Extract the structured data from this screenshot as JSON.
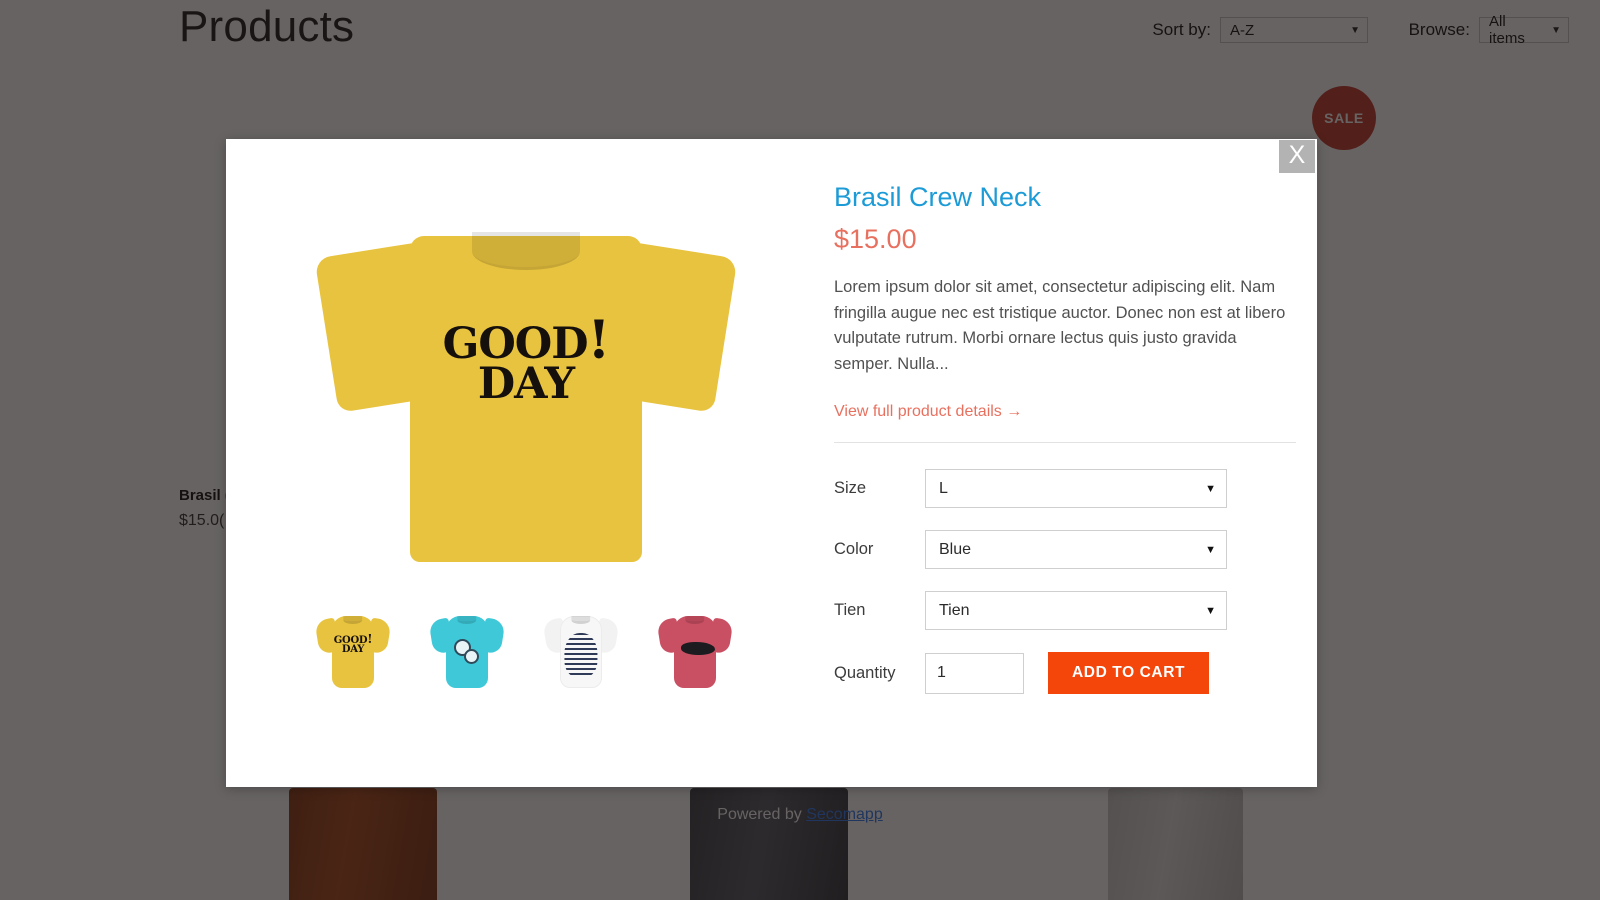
{
  "store": {
    "page_title": "Products",
    "sort": {
      "label": "Sort by:",
      "value": "A-Z",
      "caret": "▼"
    },
    "browse": {
      "label": "Browse:",
      "value": "All items",
      "caret": "▼"
    },
    "sale_badge": "SALE",
    "background_card": {
      "title": "Brasil (",
      "price": "$15.0("
    },
    "footer": {
      "prefix": "Powered by ",
      "link": "Secomapp"
    }
  },
  "modal": {
    "close_label": "X",
    "product": {
      "title": "Brasil Crew Neck",
      "price": "$15.00",
      "description": "Lorem ipsum dolor sit amet, consectetur adipiscing elit. Nam fringilla augue nec est tristique auctor. Donec non est at libero vulputate rutrum. Morbi ornare lectus quis justo gravida semper. Nulla...",
      "details_link": "View full product details →"
    },
    "gallery": {
      "hero": {
        "print_line1": "GOOD",
        "print_line2": "DAY",
        "print_bang": "!",
        "color": "#e8c33f"
      },
      "thumbnails": [
        {
          "name": "thumb-yellow-good-day",
          "color": "#e8c33f",
          "print_line1": "GOOD",
          "print_line2": "DAY",
          "print_bang": "!"
        },
        {
          "name": "thumb-turquoise-graphic",
          "color": "#3ec8d8",
          "print_line1": "",
          "print_line2": "",
          "print_bang": ""
        },
        {
          "name": "thumb-white-graphic",
          "color": "#f4f4f4",
          "print_line1": "",
          "print_line2": "",
          "print_bang": ""
        },
        {
          "name": "thumb-red-graphic",
          "color": "#c94f63",
          "print_line1": "",
          "print_line2": "",
          "print_bang": ""
        }
      ]
    },
    "options": [
      {
        "label": "Size",
        "value": "L",
        "caret": "▼"
      },
      {
        "label": "Color",
        "value": "Blue",
        "caret": "▼"
      },
      {
        "label": "Tien",
        "value": "Tien",
        "caret": "▼"
      }
    ],
    "quantity": {
      "label": "Quantity",
      "value": "1"
    },
    "add_to_cart": "ADD TO CART"
  },
  "colors": {
    "title_blue": "#1d9bd7",
    "price_coral": "#e8705f",
    "cta_orange": "#f4460a",
    "sale_red": "#c0392b",
    "link_blue": "#2f7bef"
  }
}
